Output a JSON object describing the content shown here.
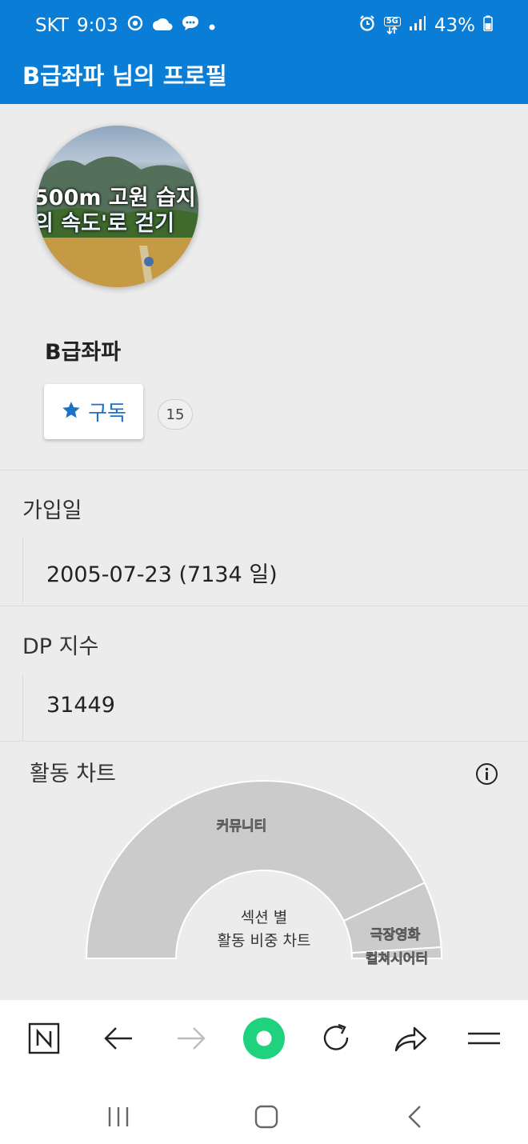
{
  "status_bar": {
    "carrier": "SKT",
    "time": "9:03",
    "network": "5G",
    "battery": "43%"
  },
  "app_bar": {
    "title": "B급좌파 님의 프로필"
  },
  "profile": {
    "avatar_caption_line1": "500m 고원 습지",
    "avatar_caption_line2": "의 속도'로 걷기",
    "username": "B급좌파",
    "subscribe_label": "구독",
    "subscriber_count": "15"
  },
  "fields": {
    "join_date_label": "가입일",
    "join_date_value": "2005-07-23 (7134 일)",
    "dp_label": "DP 지수",
    "dp_value": "31449"
  },
  "activity": {
    "title": "활동 차트",
    "center_line1": "섹션 별",
    "center_line2": "활동 비중 차트"
  },
  "chart_data": {
    "type": "pie",
    "subtype": "half-donut",
    "title": "",
    "categories": [
      "커뮤니티",
      "극장영화",
      "컬쳐시어터"
    ],
    "values": [
      86,
      12,
      2
    ]
  },
  "colors": {
    "brand_blue": "#0a7ed6",
    "accent_blue": "#1a73c9",
    "chart_fill": "#cbcbcb",
    "browser_green": "#1fd27e"
  },
  "icons": {
    "subscribe": "star-icon",
    "info": "info-icon",
    "nav": [
      "naver-n-icon",
      "back-arrow-icon",
      "forward-arrow-icon",
      "green-dot-home-icon",
      "refresh-icon",
      "share-icon",
      "menu-icon"
    ],
    "system": [
      "recent-apps-icon",
      "home-icon",
      "system-back-icon"
    ]
  }
}
